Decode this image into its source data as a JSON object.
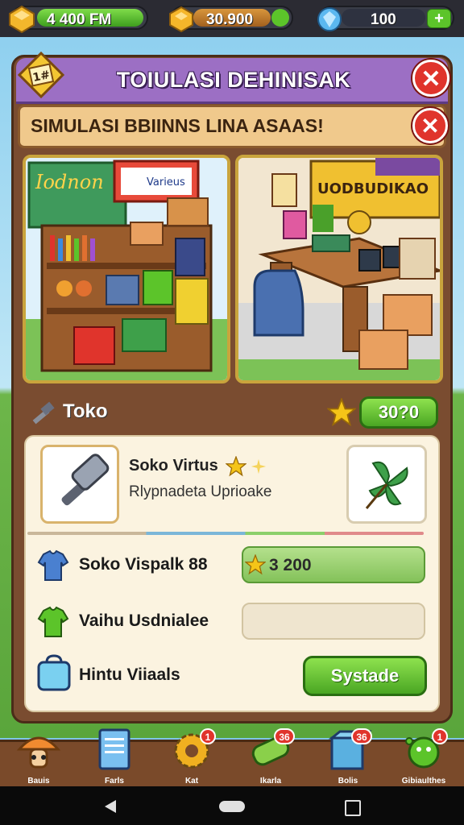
{
  "resources": {
    "gold": {
      "icon": "gold-gem-icon",
      "text": "4  400  FM"
    },
    "coins": {
      "icon": "coin-icon",
      "text": "30.900"
    },
    "gems": {
      "icon": "blue-gem-icon",
      "text": "100",
      "plus": "+"
    }
  },
  "window": {
    "title": "TOIULASI DEHINISAK",
    "close": "✕",
    "subtitle": "SIMULASI BBIINNS LINA ASAAS!",
    "subtitle_close": "✕"
  },
  "shop": {
    "left_scene_sign1": "Iodnon",
    "left_scene_sign2": "Varieus",
    "right_scene_sign": "UODBUDIKAO"
  },
  "section": {
    "label": "Toko",
    "button": "30?0"
  },
  "item": {
    "name": "Soko Virtus",
    "desc": "Rlypnadeta Uprioake"
  },
  "stats": [
    {
      "label": "Soko Vispalk 88",
      "value": "3 200",
      "icon": "shirt-icon"
    },
    {
      "label": "Vaihu Usdnialee",
      "value": "",
      "icon": "green-shirt-icon"
    },
    {
      "label": "Hintu Viiaals",
      "value": "",
      "icon": "tablet-icon",
      "button": "Systade"
    }
  ],
  "nav": [
    {
      "label": "Bauis",
      "icon": "mushroom-icon",
      "badge": ""
    },
    {
      "label": "Farls",
      "icon": "document-icon",
      "badge": ""
    },
    {
      "label": "Kat",
      "icon": "gear-icon",
      "badge": "1"
    },
    {
      "label": "Ikarla",
      "icon": "scroll-icon",
      "badge": "36"
    },
    {
      "label": "Bolis",
      "icon": "box-icon",
      "badge": "36"
    },
    {
      "label": "Gibiaulthes",
      "icon": "virus-icon",
      "badge": "1"
    }
  ],
  "colors": {
    "title_bar": "#9c6fc4",
    "panel": "#7a4c30",
    "accent_green": "#5cc42a",
    "close_red": "#e0342c"
  }
}
